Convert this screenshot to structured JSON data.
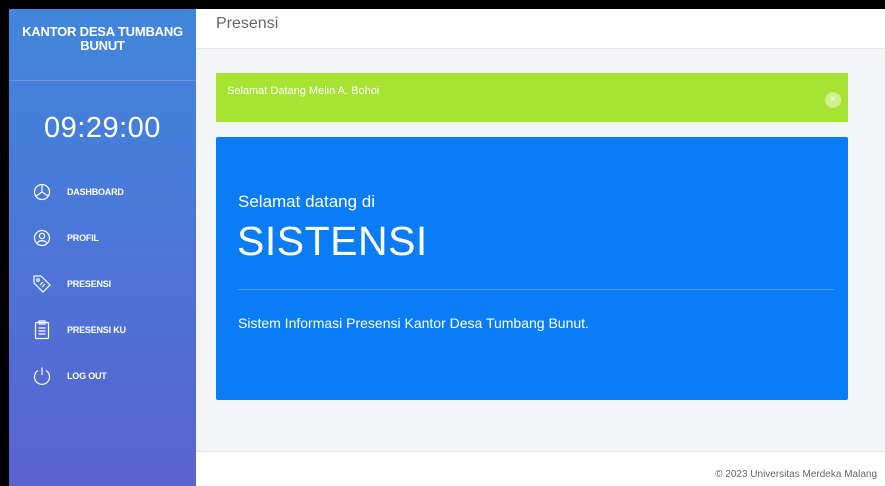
{
  "sidebar": {
    "brand": "KANTOR DESA TUMBANG BUNUT",
    "clock": "09:29:00",
    "items": [
      {
        "label": "DASHBOARD",
        "icon": "dashboard-pie-icon"
      },
      {
        "label": "PROFIL",
        "icon": "user-icon"
      },
      {
        "label": "PRESENSI",
        "icon": "tag-icon"
      },
      {
        "label": "PRESENSI KU",
        "icon": "clipboard-icon"
      },
      {
        "label": "LOG OUT",
        "icon": "power-icon"
      }
    ]
  },
  "header": {
    "title": "Presensi"
  },
  "alert": {
    "message": "Selamat Datang Melin A. Bohoi",
    "close": "×"
  },
  "hero": {
    "subtitle": "Selamat datang di",
    "title": "SISTENSI",
    "description": "Sistem Informasi Presensi Kantor Desa Tumbang Bunut."
  },
  "footer": {
    "text": "© 2023 Universitas Merdeka Malang"
  },
  "colors": {
    "sidebar_top": "#4286dc",
    "sidebar_bottom": "#5a62cf",
    "alert": "#a6e332",
    "hero": "#0a7cf6"
  }
}
